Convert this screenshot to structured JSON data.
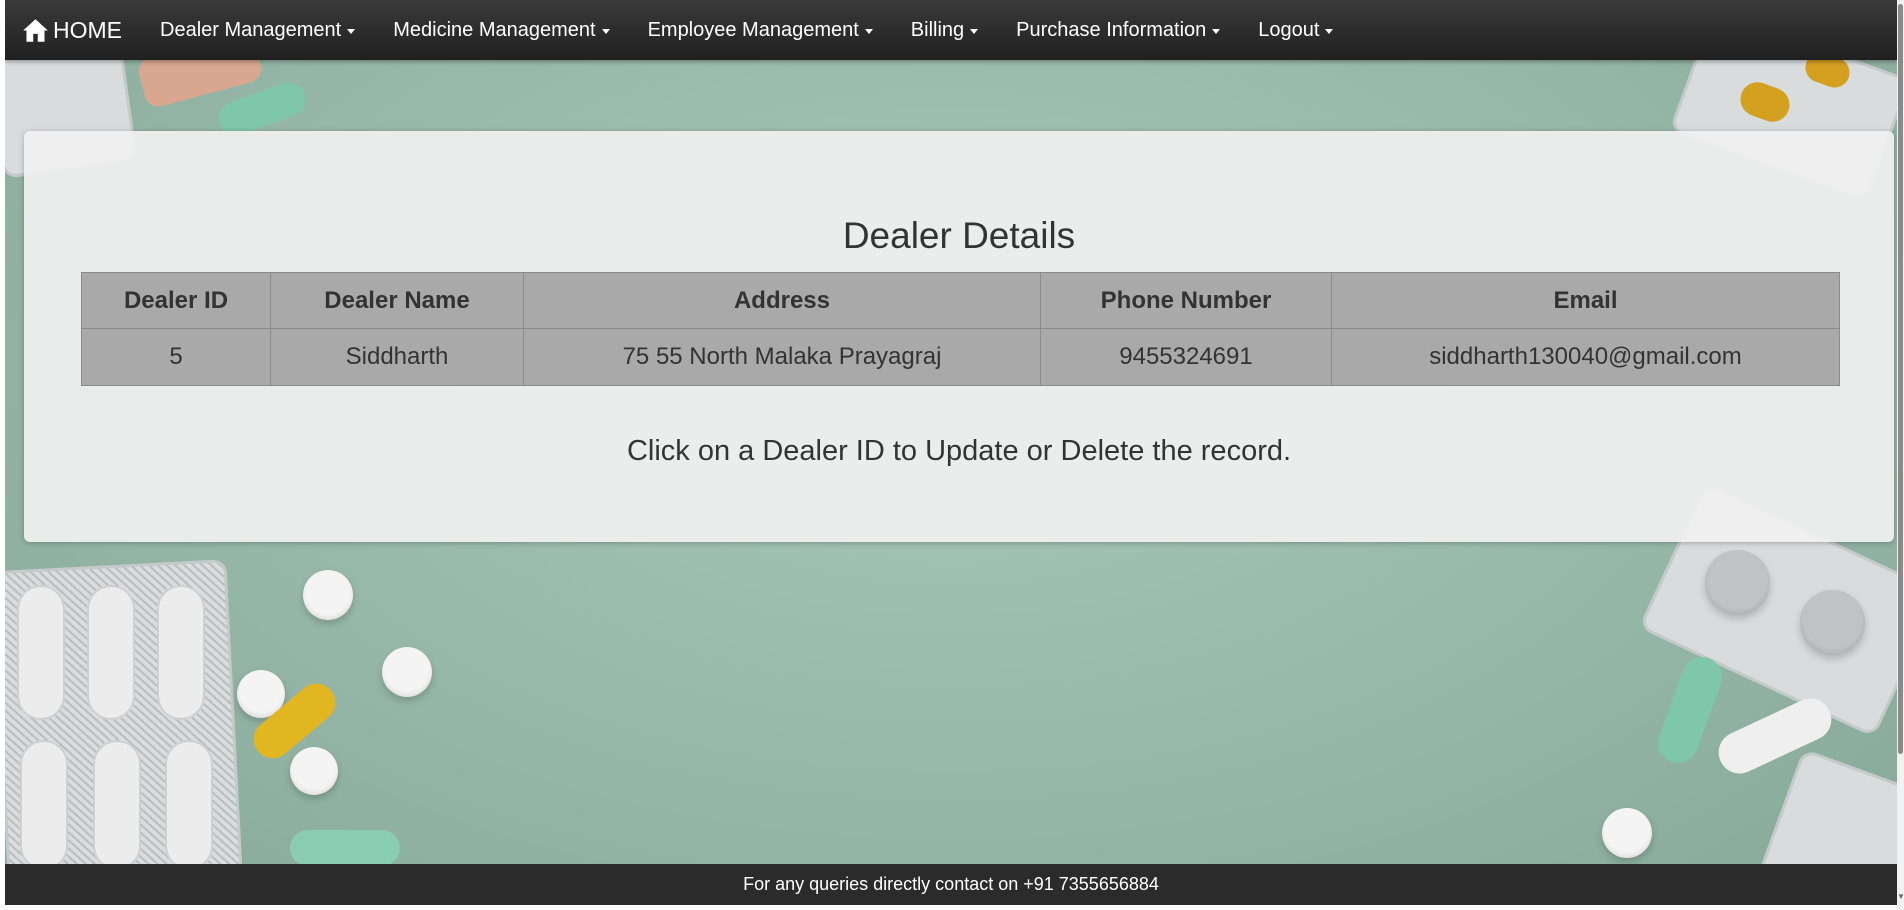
{
  "navbar": {
    "brand_label": "HOME",
    "items": [
      {
        "label": "Dealer Management"
      },
      {
        "label": "Medicine Management"
      },
      {
        "label": "Employee Management"
      },
      {
        "label": "Billing"
      },
      {
        "label": "Purchase Information"
      },
      {
        "label": "Logout"
      }
    ]
  },
  "main": {
    "title": "Dealer Details",
    "table": {
      "headers": [
        "Dealer ID",
        "Dealer Name",
        "Address",
        "Phone Number",
        "Email"
      ],
      "rows": [
        [
          "5",
          "Siddharth",
          "75 55 North Malaka Prayagraj",
          "9455324691",
          "siddharth130040@gmail.com"
        ]
      ]
    },
    "hint": "Click on a Dealer ID to Update or Delete the record."
  },
  "footer": {
    "text": "For any queries directly contact on +91 7355656884"
  },
  "colors": {
    "navbar": "#2a2a2a",
    "background": "#9bbcae",
    "table_cell": "#a9a9a9",
    "footer": "#2b2b2b"
  }
}
